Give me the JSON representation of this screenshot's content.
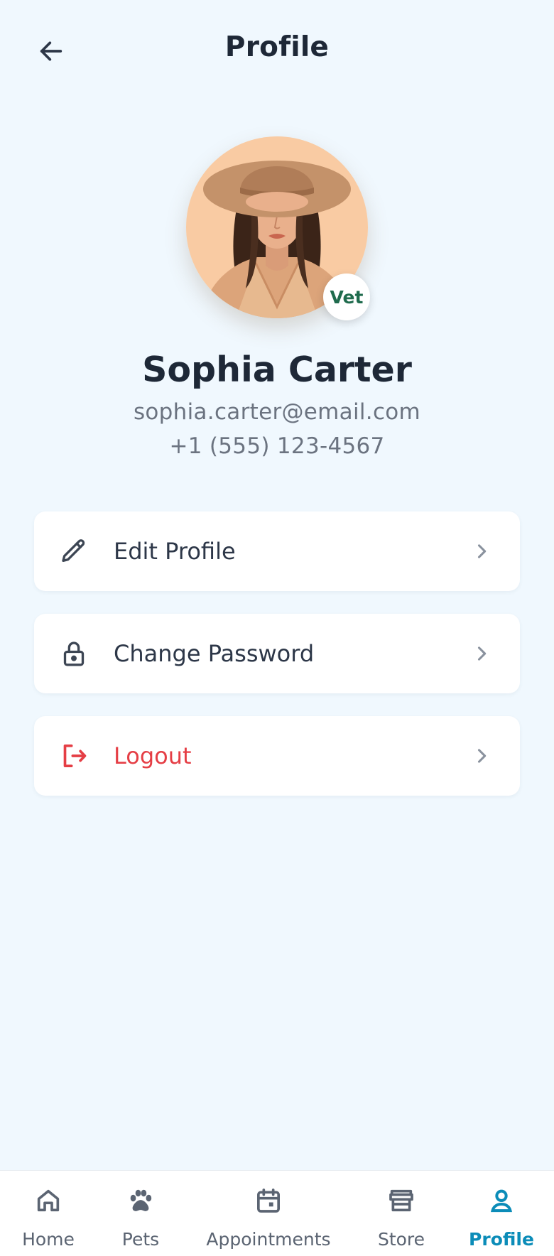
{
  "header": {
    "title": "Profile",
    "back_icon": "arrow-left-icon"
  },
  "profile": {
    "name": "Sophia Carter",
    "email": "sophia.carter@email.com",
    "phone": "+1 (555) 123-4567",
    "role_badge": "Vet",
    "avatar_icon": "avatar-illustration"
  },
  "menu": [
    {
      "label": "Edit Profile",
      "icon": "pencil-icon",
      "color": "#2d3748"
    },
    {
      "label": "Change Password",
      "icon": "lock-icon",
      "color": "#2d3748"
    },
    {
      "label": "Logout",
      "icon": "logout-icon",
      "color": "#e53e45"
    }
  ],
  "bottom_nav": {
    "items": [
      {
        "label": "Home",
        "icon": "home-icon",
        "active": false
      },
      {
        "label": "Pets",
        "icon": "paw-icon",
        "active": false
      },
      {
        "label": "Appointments",
        "icon": "calendar-icon",
        "active": false
      },
      {
        "label": "Store",
        "icon": "store-icon",
        "active": false
      },
      {
        "label": "Profile",
        "icon": "user-icon",
        "active": true
      }
    ]
  },
  "colors": {
    "background": "#f0f8fe",
    "accent": "#0b8cb8",
    "danger": "#e53e45",
    "badge_text": "#1f6b4d"
  }
}
